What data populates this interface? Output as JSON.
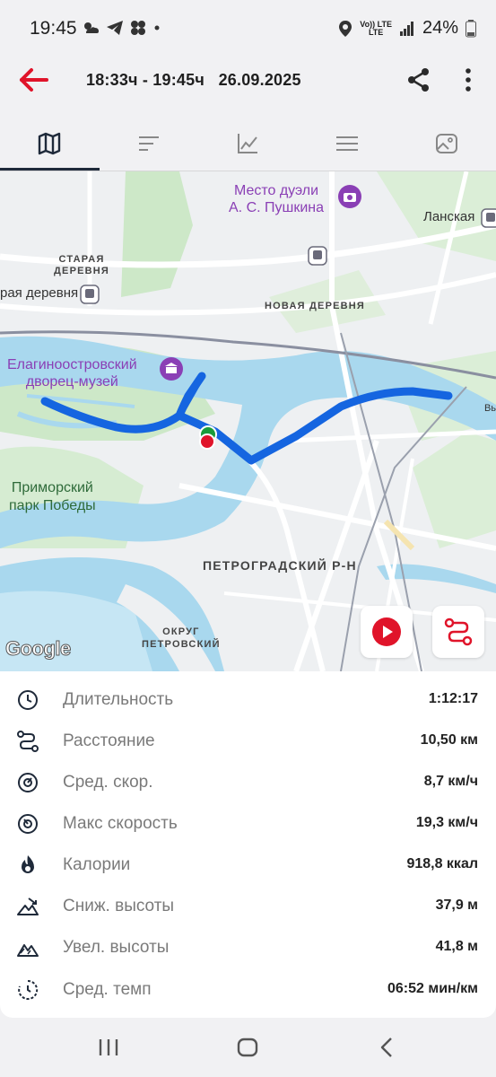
{
  "status_bar": {
    "time": "19:45",
    "battery": "24%",
    "lte_top": "Vo)) LTE",
    "lte_bottom": "LTE"
  },
  "header": {
    "title": "18:33ч - 19:45ч   26.09.2025"
  },
  "tabs": [
    {
      "icon": "map-icon",
      "active": true
    },
    {
      "icon": "list-sort-icon",
      "active": false
    },
    {
      "icon": "chart-icon",
      "active": false
    },
    {
      "icon": "menu-lines-icon",
      "active": false
    },
    {
      "icon": "photo-icon",
      "active": false
    }
  ],
  "map": {
    "labels": {
      "duel_place": "Место дуэли\nА. С. Пушкина",
      "lanskaya": "Ланская",
      "staraya_derevnya": "СТАРАЯ\nДЕРЕВНЯ",
      "staraya_derevnya_station": "рая деревня",
      "novaya_derevnya": "НОВАЯ ДЕРЕВНЯ",
      "elagin": "Елагиноостровский\nдворец-музей",
      "primorsky": "Приморский\nпарк Победы",
      "petrogradsky": "ПЕТРОГРАДСКИЙ Р-Н",
      "okrug": "ОКРУГ\nПЕТРОВСКИЙ",
      "vy": "Вы",
      "google": "Google"
    },
    "colors": {
      "route": "#1565e0",
      "water": "#a9d8ee",
      "park": "#cde8c8",
      "poi": "#8a3fb5",
      "accent_red": "#e0142a"
    }
  },
  "stats": [
    {
      "icon": "clock-icon",
      "label": "Длительность",
      "value": "1:12:17"
    },
    {
      "icon": "route-icon",
      "label": "Расстояние",
      "value": "10,50 км"
    },
    {
      "icon": "speedometer-icon",
      "label": "Сред. скор.",
      "value": "8,7 км/ч"
    },
    {
      "icon": "max-speed-icon",
      "label": "Макс скорость",
      "value": "19,3 км/ч"
    },
    {
      "icon": "calories-icon",
      "label": "Калории",
      "value": "918,8 ккал"
    },
    {
      "icon": "descent-icon",
      "label": "Сниж. высоты",
      "value": "37,9 м"
    },
    {
      "icon": "ascent-icon",
      "label": "Увел. высоты",
      "value": "41,8 м"
    },
    {
      "icon": "pace-icon",
      "label": "Сред. темп",
      "value": "06:52 мин/км"
    }
  ]
}
